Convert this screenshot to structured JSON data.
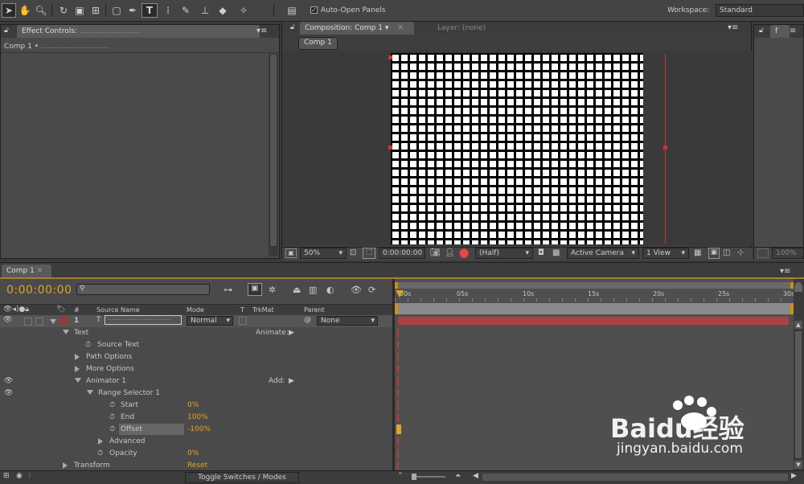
{
  "toolbar": {
    "auto_open_label": "Auto-Open Panels",
    "workspace_label": "Workspace:",
    "workspace_value": "Standard",
    "tools": [
      "selection-tool-icon",
      "hand-tool-icon",
      "zoom-tool-icon",
      "rotate-tool-icon",
      "camera-tool-icon",
      "pan-behind-tool-icon",
      "rectangle-tool-icon",
      "pen-tool-icon",
      "type-tool-icon",
      "brush-tool-icon",
      "clone-stamp-tool-icon",
      "eraser-tool-icon",
      "puppet-tool-icon"
    ]
  },
  "effect_controls": {
    "tab": "Effect Controls: ",
    "subtitle": "Comp 1 • "
  },
  "composition": {
    "tab": "Composition: Comp 1",
    "layer_tab": "Layer: (none)",
    "comp_button": "Comp 1",
    "zoom": "50%",
    "timecode": "0:00:00:00",
    "resolution": "(Half)",
    "camera": "Active Camera",
    "view": "1 View"
  },
  "right_panel": {
    "zoom": "100%"
  },
  "timeline": {
    "tab": "Comp 1",
    "timecode": "0:00:00:00",
    "search_placeholder": "",
    "columns": {
      "num": "#",
      "source_name": "Source Name",
      "mode": "Mode",
      "t": "T",
      "trkmat": "TrkMat",
      "parent": "Parent"
    },
    "layer": {
      "number": "1",
      "mode": "Normal",
      "parent": "None"
    },
    "properties": [
      {
        "label": "Text",
        "value": "",
        "extra": "Animate:"
      },
      {
        "label": "Source Text",
        "value": "",
        "extra": ""
      },
      {
        "label": "Path Options",
        "value": "",
        "extra": ""
      },
      {
        "label": "More Options",
        "value": "",
        "extra": ""
      },
      {
        "label": "Animator 1",
        "value": "",
        "extra": "Add:"
      },
      {
        "label": "Range Selector 1",
        "value": "",
        "extra": ""
      },
      {
        "label": "Start",
        "value": "0%",
        "extra": ""
      },
      {
        "label": "End",
        "value": "100%",
        "extra": ""
      },
      {
        "label": "Offset",
        "value": "-100%",
        "extra": ""
      },
      {
        "label": "Advanced",
        "value": "",
        "extra": ""
      },
      {
        "label": "Opacity",
        "value": "0%",
        "extra": ""
      },
      {
        "label": "Transform",
        "value": "Reset",
        "extra": ""
      }
    ],
    "ruler": [
      "00s",
      "05s",
      "10s",
      "15s",
      "20s",
      "25s",
      "30s"
    ],
    "toggle_label": "Toggle Switches / Modes"
  },
  "watermark": {
    "brand": "Baidu经验",
    "url": "jingyan.baidu.com"
  },
  "colors": {
    "accent_orange": "#e0a32a",
    "layer_bar": "#b04040",
    "panel_bg": "#4a4a4a"
  }
}
